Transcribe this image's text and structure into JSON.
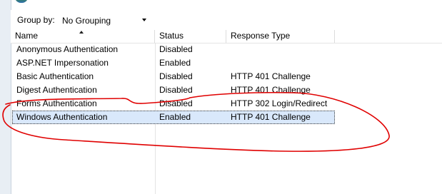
{
  "toolbar": {
    "group_by_label": "Group by:",
    "group_by_value": "No Grouping"
  },
  "columns": {
    "name": "Name",
    "status": "Status",
    "response_type": "Response Type"
  },
  "rows": [
    {
      "name": "Anonymous Authentication",
      "status": "Disabled",
      "response_type": ""
    },
    {
      "name": "ASP.NET Impersonation",
      "status": "Enabled",
      "response_type": ""
    },
    {
      "name": "Basic Authentication",
      "status": "Disabled",
      "response_type": "HTTP 401 Challenge"
    },
    {
      "name": "Digest Authentication",
      "status": "Disabled",
      "response_type": "HTTP 401 Challenge"
    },
    {
      "name": "Forms Authentication",
      "status": "Disabled",
      "response_type": "HTTP 302 Login/Redirect"
    },
    {
      "name": "Windows Authentication",
      "status": "Enabled",
      "response_type": "HTTP 401 Challenge"
    }
  ],
  "selected_row_index": 5,
  "colors": {
    "selection": "#d9e8fb",
    "annotation": "#e00000"
  }
}
